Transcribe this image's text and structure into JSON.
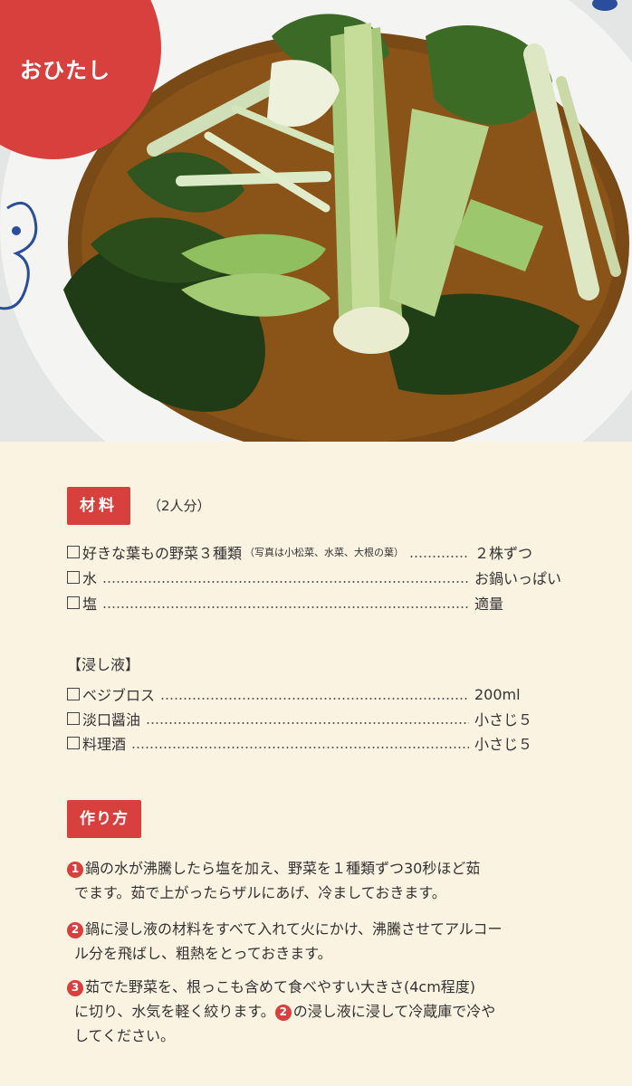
{
  "dish": {
    "title": "おひたし"
  },
  "ingredients": {
    "heading": "材料",
    "servings": "（2人分）",
    "items": [
      {
        "name": "好きな葉もの野菜３種類",
        "note": "（写真は小松菜、水菜、大根の葉）",
        "amount": "２株ずつ"
      },
      {
        "name": "水",
        "note": "",
        "amount": "お鍋いっぱい"
      },
      {
        "name": "塩",
        "note": "",
        "amount": "適量"
      }
    ]
  },
  "marinade": {
    "heading": "【浸し液】",
    "items": [
      {
        "name": "ベジブロス",
        "amount": "200ml"
      },
      {
        "name": "淡口醤油",
        "amount": "小さじ５"
      },
      {
        "name": "料理酒",
        "amount": "小さじ５"
      }
    ]
  },
  "method": {
    "heading": "作り方",
    "steps": [
      {
        "number": "1",
        "line1": "鍋の水が沸騰したら塩を加え、野菜を１種類ずつ30秒ほど茹",
        "line2": "でます。茹で上がったらザルにあげ、冷ましておきます。"
      },
      {
        "number": "2",
        "line1": "鍋に浸し液の材料をすべて入れて火にかけ、沸騰させてアルコー",
        "line2": "ル分を飛ばし、粗熱をとっておきます。"
      },
      {
        "number": "3",
        "line1": "茹でた野菜を、根っこも含めて食べやすい大きさ(4cm程度)",
        "line2a": "に切り、水気を軽く絞ります。",
        "ref": "2",
        "line2b": "の浸し液に浸して冷蔵庫で冷や",
        "line3": "してください。"
      }
    ]
  },
  "colors": {
    "accent": "#d8403d",
    "background": "#fbf3e1"
  }
}
